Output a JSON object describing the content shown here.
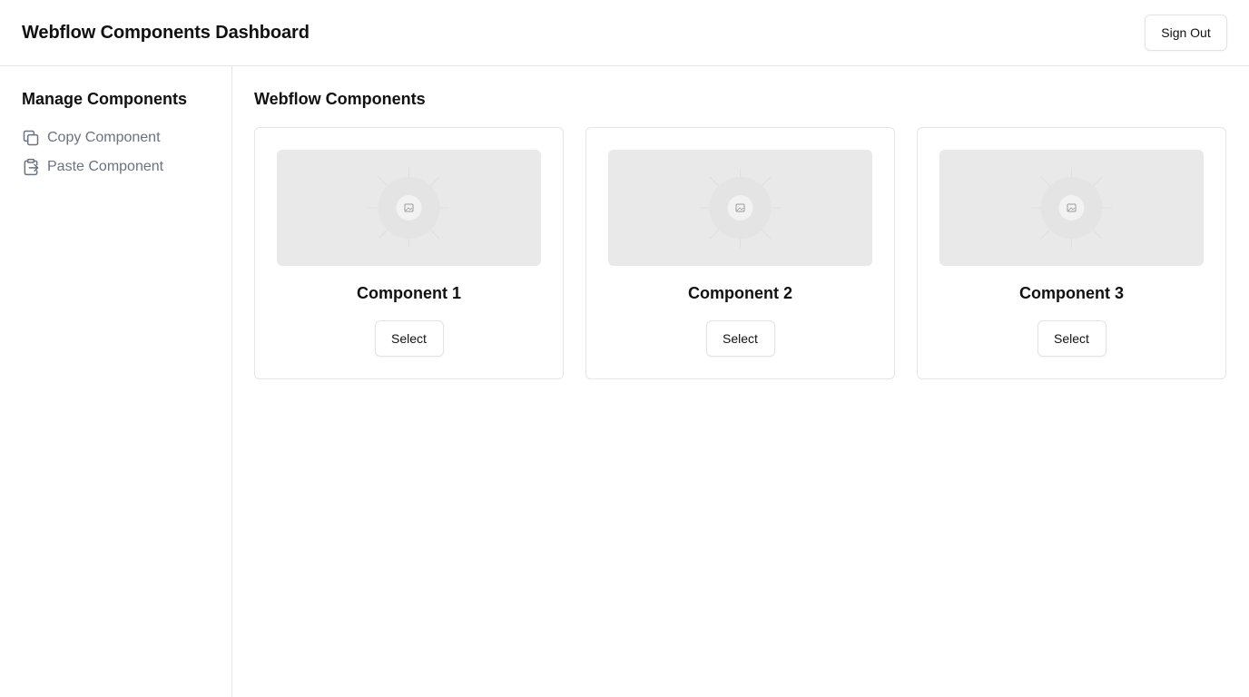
{
  "header": {
    "title": "Webflow Components Dashboard",
    "signout_label": "Sign Out"
  },
  "sidebar": {
    "heading": "Manage Components",
    "items": [
      {
        "label": "Copy Component",
        "icon": "copy-icon"
      },
      {
        "label": "Paste Component",
        "icon": "paste-icon"
      }
    ]
  },
  "main": {
    "heading": "Webflow Components",
    "cards": [
      {
        "title": "Component 1",
        "button": "Select",
        "image": "image-placeholder-icon"
      },
      {
        "title": "Component 2",
        "button": "Select",
        "image": "image-placeholder-icon"
      },
      {
        "title": "Component 3",
        "button": "Select",
        "image": "image-placeholder-icon"
      }
    ]
  },
  "colors": {
    "border": "#e5e5e5",
    "placeholder": "#e9e9e9",
    "muted_text": "#6b7280"
  }
}
